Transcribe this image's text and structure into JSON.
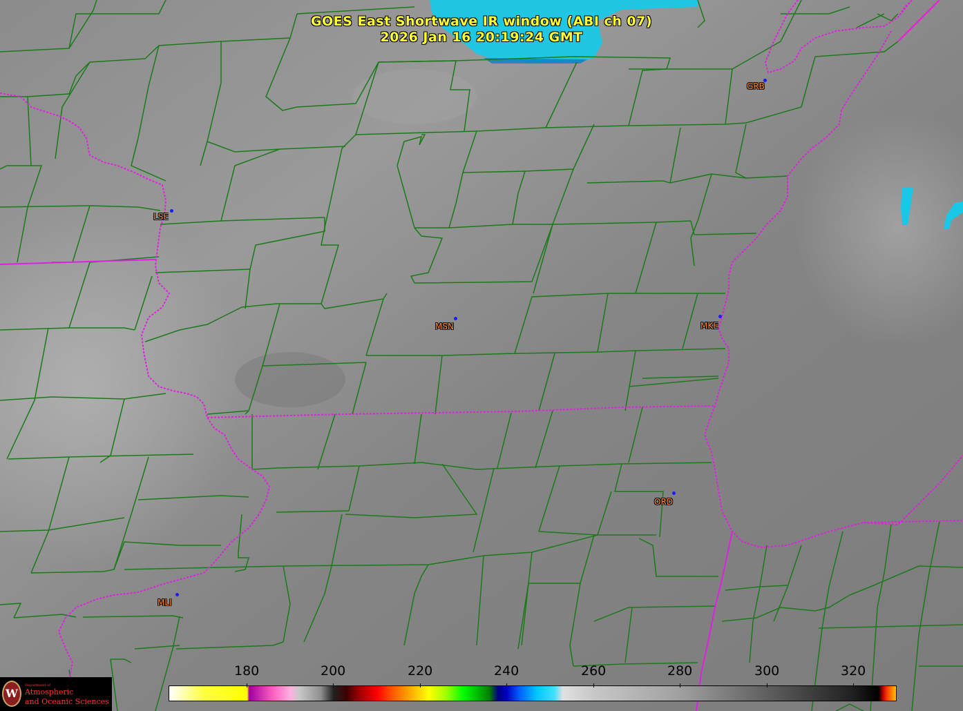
{
  "title": {
    "line1": "GOES East Shortwave IR window (ABI ch 07)",
    "line2": "2026 Jan 16  20:19:24 GMT"
  },
  "cities": [
    {
      "code": "GRB"
    },
    {
      "code": "LSE"
    },
    {
      "code": "MSN"
    },
    {
      "code": "MKE"
    },
    {
      "code": "ORD"
    },
    {
      "code": "MLI"
    }
  ],
  "colorbar": {
    "tick_labels": [
      "180",
      "200",
      "220",
      "240",
      "260",
      "280",
      "300",
      "320"
    ],
    "min_value": 162,
    "max_value": 330
  },
  "logo": {
    "dept_text": "Department of",
    "name_line1": "Atmospheric",
    "name_line2": "and Oceanic Sciences",
    "seal_letter": "W"
  },
  "colors": {
    "title": "#ffff33",
    "county_lines": "#1a7a1a",
    "state_lines": "#e020e0",
    "city_label": "#ff8c2a",
    "city_dot": "#1a1aff",
    "cold_cloud": "#19c8e6"
  }
}
